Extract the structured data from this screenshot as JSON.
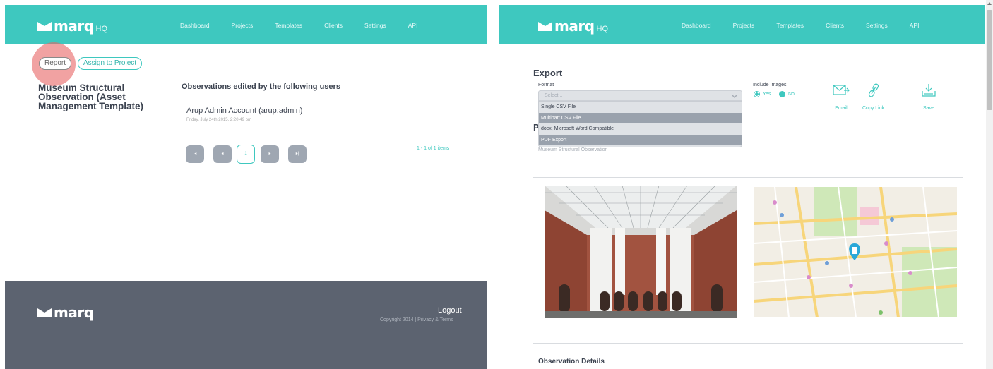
{
  "brand": {
    "name": "marq",
    "suffix": "HQ"
  },
  "nav": [
    "Dashboard",
    "Projects",
    "Templates",
    "Clients",
    "Settings",
    "API"
  ],
  "left": {
    "buttons": {
      "report": "Report",
      "assign": "Assign to Project"
    },
    "observation_title": "Museum Structural Observation (Asset Management Template)",
    "edited_heading": "Observations edited by the following users",
    "users": [
      {
        "name": "Arup Admin Account (arup.admin)",
        "date": "Friday, July 24th 2015, 2:20:49 pm"
      }
    ],
    "pagination": {
      "first": "⏮",
      "prev": "◀",
      "current": "1",
      "next": "▶",
      "last": "⏭",
      "summary": "1 - 1 of 1 items"
    },
    "footer": {
      "logout": "Logout",
      "copyright": "Copyright 2014 | Privacy & Terms"
    }
  },
  "right": {
    "export": {
      "title": "Export",
      "format_label": "Format",
      "select_placeholder": "Select...",
      "options": [
        "Single CSV File",
        "Multipart CSV File",
        "docx, Microsoft Word Compatible",
        "PDF Export"
      ],
      "highlighted_options": [
        1,
        3
      ],
      "include_images_label": "Include Images",
      "radio_yes": "Yes",
      "radio_no": "No",
      "include_images_selected": "Yes",
      "actions": {
        "email": "Email",
        "copy_link": "Copy Link",
        "save": "Save"
      }
    },
    "project_heading_initial": "P",
    "project_subtitle": "Museum Structural Observation",
    "details_title": "Observation Details"
  },
  "colors": {
    "teal": "#3ec8bf",
    "footer": "#5c6370",
    "text": "#3c4350"
  }
}
